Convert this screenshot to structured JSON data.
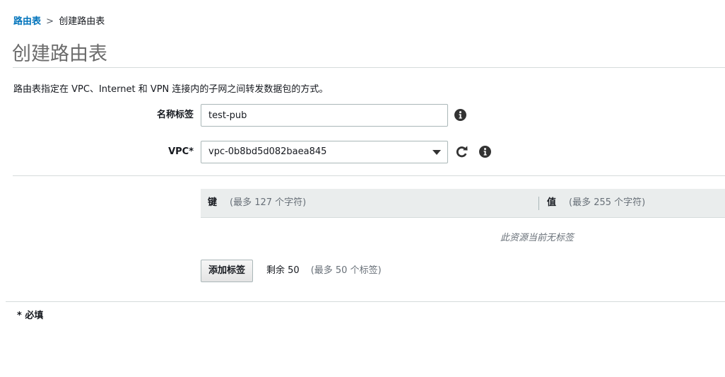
{
  "breadcrumb": {
    "parent": "路由表",
    "separator": ">",
    "current": "创建路由表"
  },
  "page": {
    "title": "创建路由表",
    "description": "路由表指定在 VPC、Internet 和 VPN 连接内的子网之间转发数据包的方式。"
  },
  "form": {
    "name_tag": {
      "label": "名称标签",
      "value": "test-pub"
    },
    "vpc": {
      "label": "VPC*",
      "selected": "vpc-0b8bd5d082baea845"
    }
  },
  "tags": {
    "key_header": "键",
    "key_hint": "(最多 127 个字符)",
    "value_header": "值",
    "value_hint": "(最多 255 个字符)",
    "empty_message": "此资源当前无标签",
    "add_button": "添加标签",
    "remaining": "剩余 50",
    "limit_hint": "(最多 50 个标签)"
  },
  "footer": {
    "required_note": "* 必填"
  },
  "icons": {
    "info": "info-icon",
    "refresh": "refresh-icon",
    "dropdown": "chevron-down-icon"
  },
  "colors": {
    "link": "#0073bb",
    "title": "#6b6b6b",
    "table_header_bg": "#eaeded",
    "border": "#aab7b8"
  }
}
